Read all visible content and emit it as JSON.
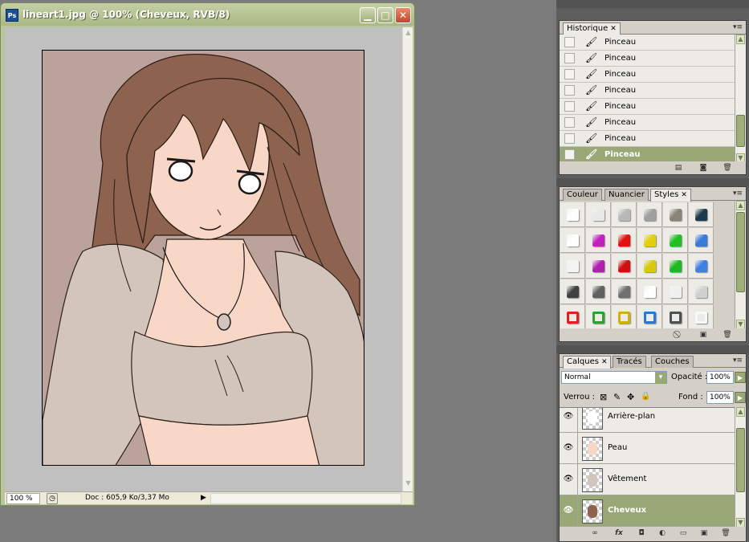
{
  "document": {
    "title": "lineart1.jpg @ 100% (Cheveux, RVB/8)",
    "app_icon": "Ps",
    "min_icon": "minimize-icon",
    "max_icon": "maximize-icon",
    "close_icon": "close-icon",
    "zoom": "100 %",
    "doc_size": "Doc : 605,9 Ko/3,37 Mo"
  },
  "history": {
    "tab": "Historique",
    "items": [
      "Pinceau",
      "Pinceau",
      "Pinceau",
      "Pinceau",
      "Pinceau",
      "Pinceau",
      "Pinceau",
      "Pinceau"
    ],
    "selected_index": 7
  },
  "styles": {
    "tabs": [
      "Couleur",
      "Nuancier",
      "Styles"
    ],
    "active_tab": "Styles",
    "swatches": [
      "#ffffff",
      "#e8e8e8",
      "#b8b8b8",
      "#a0a0a0",
      "#8a8478",
      "#1c3a4a",
      "#ffffff",
      "#c020c0",
      "#e01010",
      "#e0d010",
      "#20c020",
      "#3a7ad8",
      "#f4f4f4",
      "#b020b0",
      "#d01010",
      "#d8c810",
      "#20b820",
      "#4080e0",
      "#404040",
      "#606060",
      "#707070",
      "#ffffff",
      "#f0f0f0",
      "#d0d0d0",
      "#e02020",
      "#30a030",
      "#d0b010",
      "#2a78d0",
      "#505050",
      "#f8f8f8"
    ]
  },
  "layers": {
    "tabs": [
      "Calques",
      "Tracés",
      "Couches"
    ],
    "active_tab": "Calques",
    "blend_mode": "Normal",
    "opacity_label": "Opacité :",
    "opacity": "100%",
    "lock_label": "Verrou :",
    "fill_label": "Fond :",
    "fill": "100%",
    "items": [
      "Arrière-plan",
      "Peau",
      "Vêtement",
      "Cheveux"
    ],
    "selected_index": 3
  },
  "colors": {
    "accent": "#9aa878",
    "titlebar": "#b9c59a",
    "canvas_bg": "#bba39b",
    "skin": "#f9d7c6",
    "hair": "#8d6350",
    "cloth": "#d3c5bb"
  }
}
